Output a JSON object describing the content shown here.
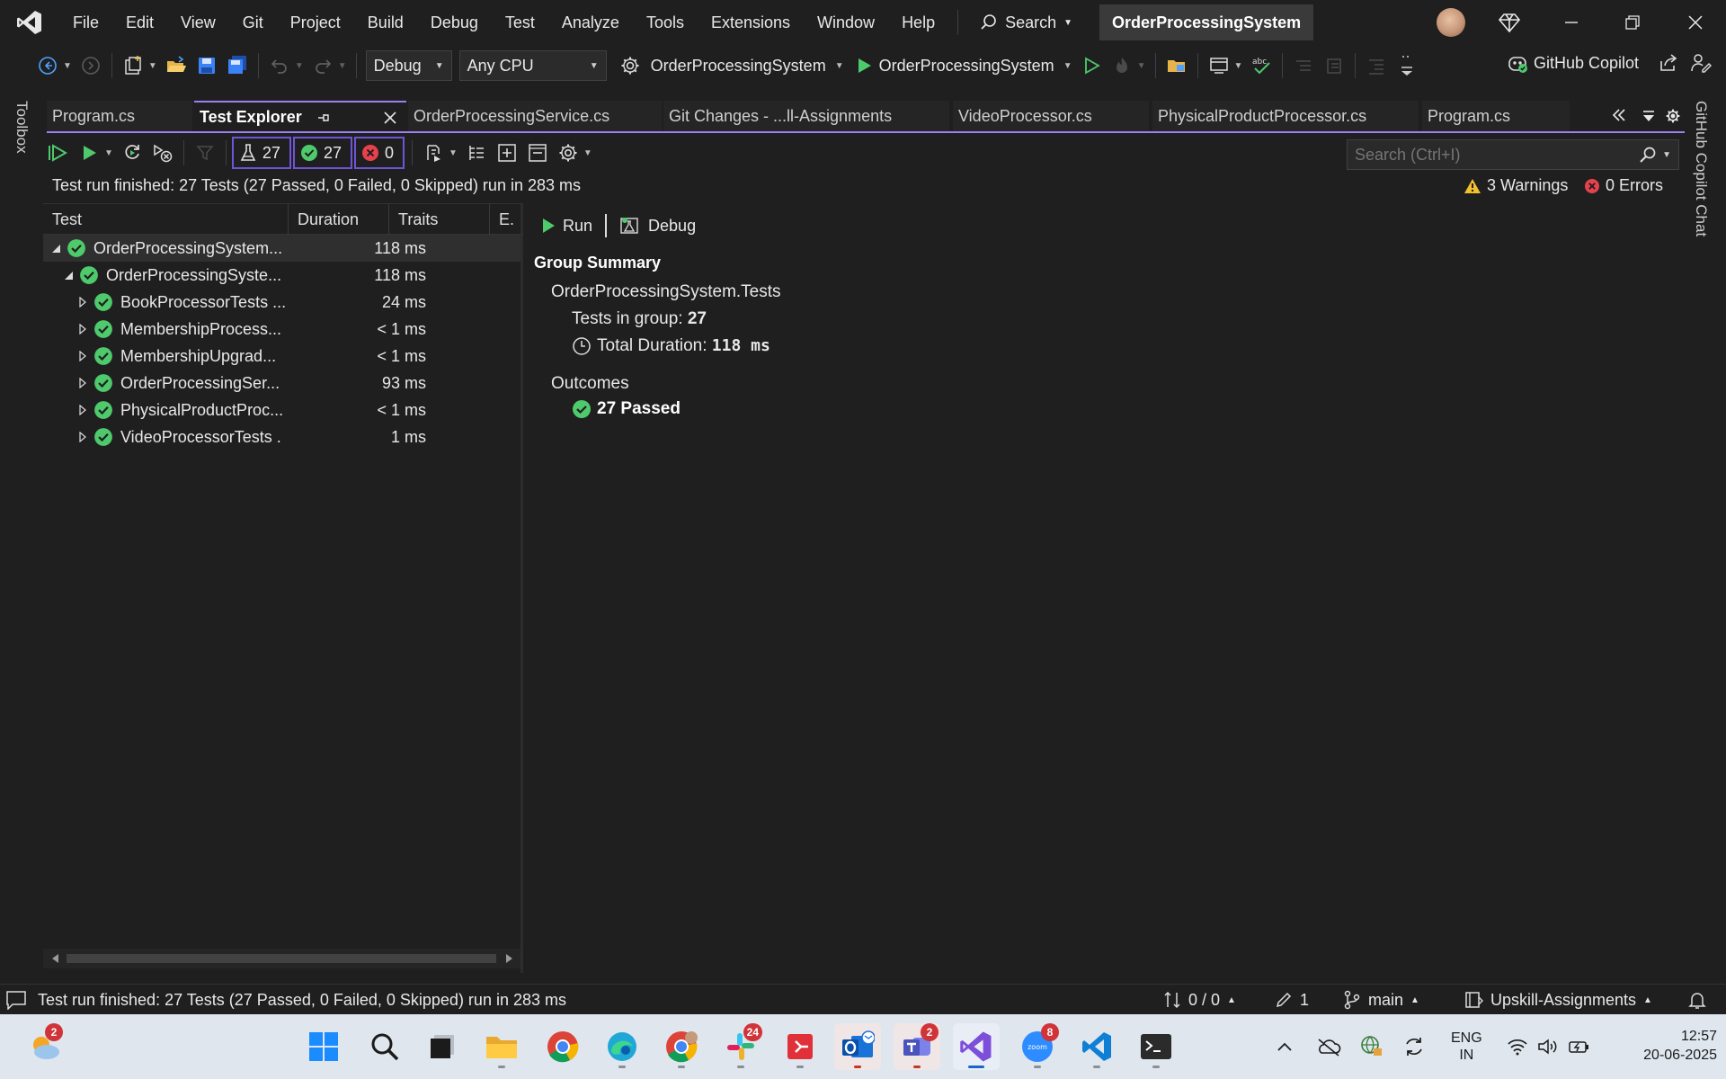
{
  "menubar": {
    "items": [
      "File",
      "Edit",
      "View",
      "Git",
      "Project",
      "Build",
      "Debug",
      "Test",
      "Analyze",
      "Tools",
      "Extensions",
      "Window",
      "Help"
    ],
    "search_label": "Search",
    "solution_title": "OrderProcessingSystem"
  },
  "toolbar": {
    "configuration": "Debug",
    "platform": "Any CPU",
    "startup_project": "OrderProcessingSystem",
    "run_target": "OrderProcessingSystem",
    "copilot_label": "GitHub Copilot"
  },
  "side": {
    "left_label": "Toolbox",
    "right_label": "GitHub Copilot Chat"
  },
  "tabs": [
    {
      "label": "Program.cs"
    },
    {
      "label": "Test Explorer"
    },
    {
      "label": "OrderProcessingService.cs"
    },
    {
      "label": "Git Changes - ...ll-Assignments"
    },
    {
      "label": "VideoProcessor.cs"
    },
    {
      "label": "PhysicalProductProcessor.cs"
    },
    {
      "label": "Program.cs"
    }
  ],
  "test_explorer": {
    "counts": {
      "total": "27",
      "passed": "27",
      "failed": "0"
    },
    "search_placeholder": "Search (Ctrl+I)",
    "run_summary": "Test run finished: 27 Tests (27 Passed, 0 Failed, 0 Skipped) run in 283 ms",
    "warnings": "3 Warnings",
    "errors": "0 Errors",
    "columns": [
      "Test",
      "Duration",
      "Traits",
      "E."
    ],
    "rows": [
      {
        "name": "OrderProcessingSystem...",
        "duration": "118 ms",
        "level": 0,
        "expanded": true
      },
      {
        "name": "OrderProcessingSyste...",
        "duration": "118 ms",
        "level": 1,
        "expanded": true
      },
      {
        "name": "BookProcessorTests ...",
        "duration": "24 ms",
        "level": 2,
        "expanded": false
      },
      {
        "name": "MembershipProcess...",
        "duration": "< 1 ms",
        "level": 2,
        "expanded": false
      },
      {
        "name": "MembershipUpgrad...",
        "duration": "< 1 ms",
        "level": 2,
        "expanded": false
      },
      {
        "name": "OrderProcessingSer...",
        "duration": "93 ms",
        "level": 2,
        "expanded": false
      },
      {
        "name": "PhysicalProductProc...",
        "duration": "< 1 ms",
        "level": 2,
        "expanded": false
      },
      {
        "name": "VideoProcessorTests .",
        "duration": "1 ms",
        "level": 2,
        "expanded": false
      }
    ]
  },
  "details": {
    "run_label": "Run",
    "debug_label": "Debug",
    "title": "Group Summary",
    "group_name": "OrderProcessingSystem.Tests",
    "tests_in_group_label": "Tests in group",
    "tests_in_group_value": "27",
    "total_duration_label": "Total Duration",
    "total_duration_value": "118 ms",
    "outcomes_label": "Outcomes",
    "passed_label": "27 Passed"
  },
  "statusbar": {
    "message": "Test run finished: 27 Tests (27 Passed, 0 Failed, 0 Skipped) run in 283 ms",
    "sync": "0 / 0",
    "pending_changes": "1",
    "branch": "main",
    "repo": "Upskill-Assignments"
  },
  "taskbar": {
    "weather_badge": "2",
    "slack_badge": "24",
    "teams_badge": "2",
    "zoom_badge": "8",
    "language": "ENG",
    "region": "IN",
    "time": "12:57",
    "date": "20-06-2025"
  },
  "colors": {
    "accent": "#9d80ef",
    "passed": "#4ec96b",
    "failed": "#e8414d",
    "warning": "#f2c12e"
  }
}
